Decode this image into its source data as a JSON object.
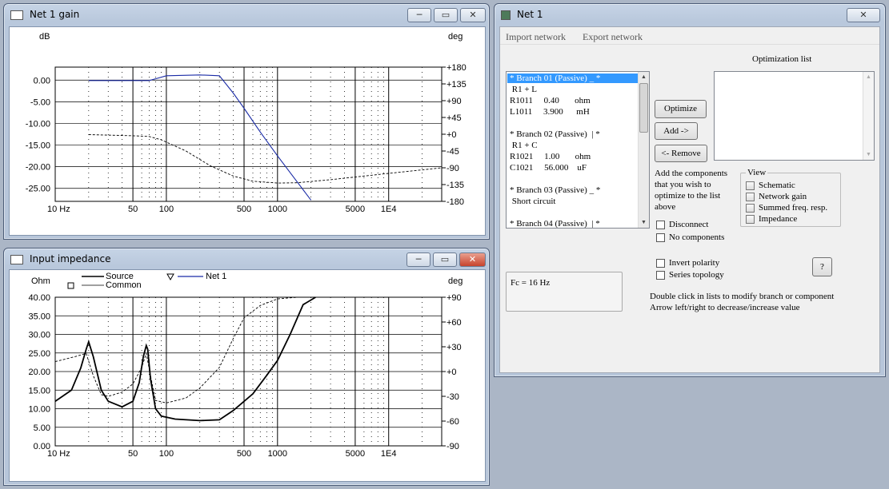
{
  "gain_window": {
    "title": "Net 1 gain",
    "left_unit": "dB",
    "right_unit": "deg",
    "y_ticks_left": [
      "0.00",
      "-5.00",
      "-10.00",
      "-15.00",
      "-20.00",
      "-25.00"
    ],
    "y_ticks_right": [
      "+180",
      "+135",
      "+90",
      "+45",
      "+0",
      "-45",
      "-90",
      "-135",
      "-180"
    ],
    "x_ticks": [
      "10 Hz",
      "50",
      "100",
      "500",
      "1000",
      "5000",
      "1E4"
    ]
  },
  "impedance_window": {
    "title": "Input impedance",
    "left_unit": "Ohm",
    "right_unit": "deg",
    "legend": {
      "source": "Source",
      "common": "Common",
      "net": "Net 1"
    },
    "y_ticks_left": [
      "40.00",
      "35.00",
      "30.00",
      "25.00",
      "20.00",
      "15.00",
      "10.00",
      "5.00",
      "0.00"
    ],
    "y_ticks_right": [
      "+90",
      "+60",
      "+30",
      "+0",
      "-30",
      "-60",
      "-90"
    ],
    "x_ticks": [
      "10 Hz",
      "50",
      "100",
      "500",
      "1000",
      "5000",
      "1E4"
    ]
  },
  "net_window": {
    "title": "Net 1",
    "menu": {
      "import": "Import network",
      "export": "Export network"
    },
    "branches": [
      "* Branch 01 (Passive) _ *",
      " R1 + L",
      "R1011     0.40       ohm",
      "L1011     3.900      mH",
      "",
      "* Branch 02 (Passive)  | *",
      " R1 + C",
      "R1021     1.00       ohm",
      "C1021     56.000    uF",
      "",
      "* Branch 03 (Passive) _ *",
      " Short circuit",
      "",
      "* Branch 04 (Passive)  | *"
    ],
    "optimization_label": "Optimization list",
    "buttons": {
      "optimize": "Optimize",
      "add": "Add ->",
      "remove": "<- Remove",
      "help": "?"
    },
    "instructions": [
      "Add the components",
      "that you wish to",
      "optimize to the list",
      "above"
    ],
    "checks": {
      "disconnect": "Disconnect",
      "no_components": "No components",
      "invert": "Invert polarity",
      "series": "Series topology"
    },
    "view": {
      "label": "View",
      "items": [
        "Schematic",
        "Network gain",
        "Summed freq. resp.",
        "Impedance"
      ]
    },
    "fc": "Fc = 16 Hz",
    "hints": [
      "Double click in lists to modify branch or component",
      "Arrow left/right to decrease/increase value"
    ]
  },
  "chart_data": [
    {
      "type": "line",
      "title": "Net 1 gain",
      "ylabel": "dB",
      "y2label": "deg",
      "xscale": "log",
      "xlim": [
        10,
        30000
      ],
      "ylim": [
        -28,
        3
      ],
      "y2lim": [
        -180,
        180
      ],
      "x_ticks": [
        10,
        50,
        100,
        500,
        1000,
        5000,
        10000
      ],
      "series": [
        {
          "axis": "left",
          "style": "solid",
          "color": "#1a2ba6",
          "x": [
            20,
            50,
            70,
            80,
            100,
            200,
            300,
            400,
            500,
            700,
            1000,
            1500,
            2000
          ],
          "y": [
            -0.1,
            -0.1,
            -0.1,
            0.3,
            1.0,
            1.2,
            1.0,
            -3.0,
            -6.5,
            -12.0,
            -17.5,
            -23.5,
            -27.7
          ]
        },
        {
          "axis": "right",
          "style": "dashed",
          "color": "#000000",
          "x": [
            20,
            50,
            70,
            90,
            150,
            250,
            400,
            600,
            1000,
            1500,
            3000,
            10000,
            30000
          ],
          "y": [
            -1,
            -4,
            -6,
            -15,
            -45,
            -85,
            -112,
            -126,
            -131,
            -130,
            -122,
            -105,
            -90
          ]
        }
      ]
    },
    {
      "type": "line",
      "title": "Input impedance",
      "ylabel": "Ohm",
      "y2label": "deg",
      "xscale": "log",
      "xlim": [
        10,
        30000
      ],
      "ylim": [
        0,
        40
      ],
      "y2lim": [
        -90,
        90
      ],
      "x_ticks": [
        10,
        50,
        100,
        500,
        1000,
        5000,
        10000
      ],
      "series": [
        {
          "name": "Net 1",
          "axis": "left",
          "style": "solid",
          "color": "#000000",
          "x": [
            10,
            14,
            17,
            19,
            20,
            22,
            26,
            30,
            40,
            50,
            57,
            62,
            66,
            68,
            72,
            80,
            90,
            120,
            200,
            300,
            400,
            600,
            800,
            1000,
            1300,
            1700,
            2200
          ],
          "y": [
            12,
            15,
            21,
            26,
            28,
            24,
            15,
            12,
            10.5,
            12,
            17,
            24,
            27,
            26,
            18,
            10,
            8,
            7.2,
            6.8,
            7,
            9.5,
            14,
            19,
            23,
            30,
            38,
            42
          ]
        },
        {
          "axis": "right",
          "style": "dashed",
          "color": "#000000",
          "x": [
            10,
            15,
            19,
            22,
            26,
            30,
            40,
            50,
            60,
            66,
            72,
            80,
            100,
            150,
            200,
            300,
            400,
            500,
            700,
            1000,
            1500,
            2000,
            5000,
            30000
          ],
          "y": [
            12,
            18,
            22,
            -5,
            -28,
            -30,
            -25,
            -15,
            5,
            22,
            -5,
            -35,
            -38,
            -32,
            -20,
            5,
            40,
            65,
            80,
            88,
            90,
            90,
            90,
            90
          ]
        }
      ]
    }
  ]
}
